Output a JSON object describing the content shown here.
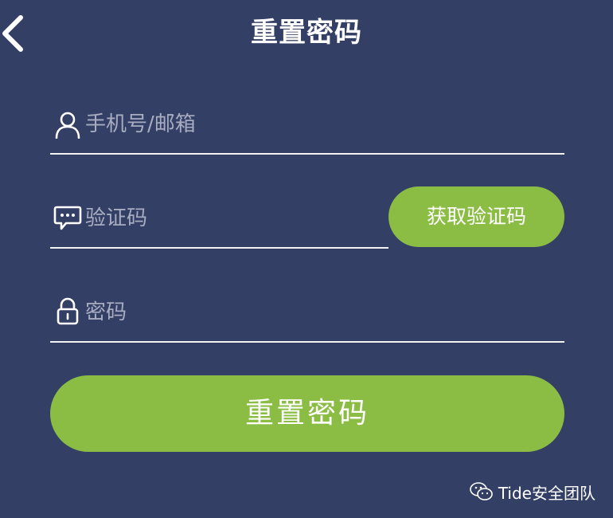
{
  "header": {
    "title": "重置密码",
    "back_icon": "chevron-left-icon"
  },
  "form": {
    "phone": {
      "placeholder": "手机号/邮箱",
      "value": "",
      "icon": "user-icon"
    },
    "code": {
      "placeholder": "验证码",
      "value": "",
      "icon": "message-icon",
      "get_code_label": "获取验证码"
    },
    "password": {
      "placeholder": "密码",
      "value": "",
      "icon": "lock-icon"
    },
    "submit_label": "重置密码"
  },
  "watermark": {
    "text": "Tide安全团队",
    "icon": "wechat-icon"
  },
  "colors": {
    "background": "#343f66",
    "accent": "#8bbd45",
    "text": "#ffffff",
    "placeholder": "#a7acc1"
  }
}
